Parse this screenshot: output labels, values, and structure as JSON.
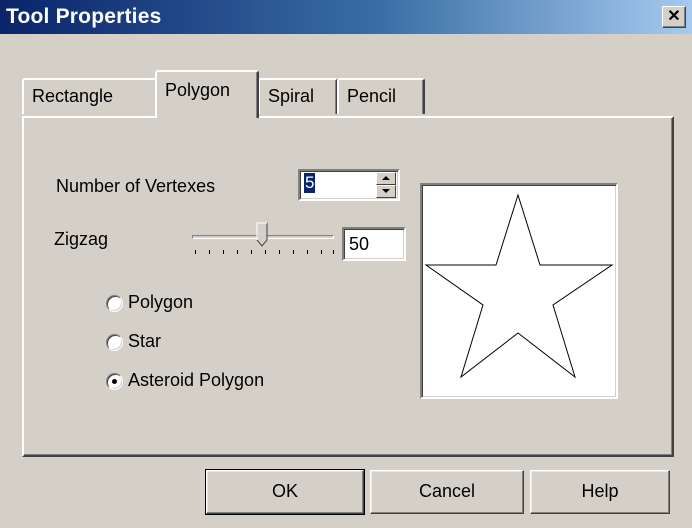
{
  "window": {
    "title": "Tool Properties",
    "close_glyph": "✕"
  },
  "tabs": [
    {
      "label": "Rectangle",
      "active": false
    },
    {
      "label": "Polygon",
      "active": true
    },
    {
      "label": "Spiral",
      "active": false
    },
    {
      "label": "Pencil",
      "active": false
    }
  ],
  "vertexes": {
    "label": "Number of Vertexes",
    "value": "5"
  },
  "zigzag": {
    "label": "Zigzag",
    "value": "50",
    "slider_fraction": 0.5
  },
  "shape_options": [
    {
      "label": "Polygon",
      "checked": false
    },
    {
      "label": "Star",
      "checked": false
    },
    {
      "label": "Asteroid Polygon",
      "checked": true
    }
  ],
  "preview": {
    "shape": "star"
  },
  "buttons": {
    "ok": "OK",
    "cancel": "Cancel",
    "help": "Help"
  }
}
